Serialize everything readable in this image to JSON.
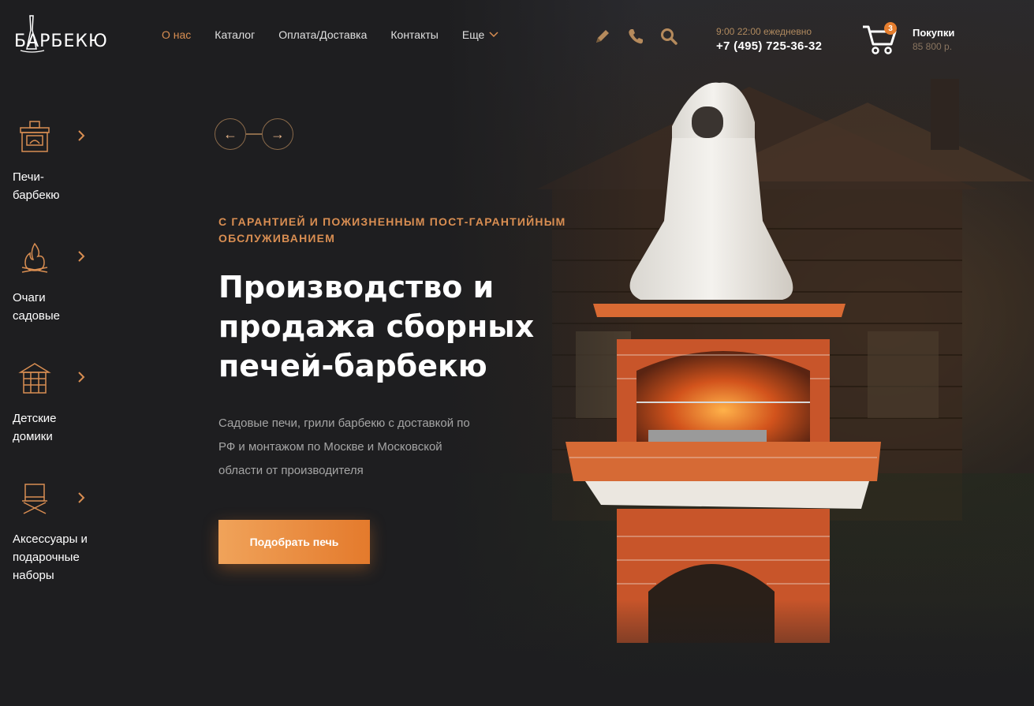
{
  "brand": {
    "logo_text": "БАРБЕКЮ"
  },
  "nav": {
    "items": [
      {
        "label": "О нас",
        "active": true
      },
      {
        "label": "Каталог",
        "active": false
      },
      {
        "label": "Оплата/Доставка",
        "active": false
      },
      {
        "label": "Контакты",
        "active": false
      }
    ],
    "more_label": "Еще"
  },
  "header": {
    "icons": [
      "pencil-icon",
      "phone-icon",
      "search-icon"
    ],
    "hours": "9:00 22:00 ежедневно",
    "phone": "+7 (495) 725-36-32",
    "cart": {
      "badge": "3",
      "label": "Покупки",
      "total": "85 800 р."
    }
  },
  "sidebar": {
    "items": [
      {
        "icon": "stove-icon",
        "label_line1": "Печи-",
        "label_line2": "барбекю",
        "label_line3": ""
      },
      {
        "icon": "fire-icon",
        "label_line1": "Очаги",
        "label_line2": "садовые",
        "label_line3": ""
      },
      {
        "icon": "gazebo-icon",
        "label_line1": "Детские",
        "label_line2": "домики",
        "label_line3": ""
      },
      {
        "icon": "chair-icon",
        "label_line1": "Аксессуары и",
        "label_line2": "подарочные",
        "label_line3": "наборы"
      }
    ]
  },
  "hero": {
    "eyebrow": "С ГАРАНТИЕЙ И ПОЖИЗНЕННЫМ ПОСТ-ГАРАНТИЙНЫМ ОБСЛУЖИВАНИЕМ",
    "headline_line1": "Производство и",
    "headline_line2": "продажа сборных",
    "headline_line3": "печей-барбекю",
    "subtext": "Садовые печи, грили барбекю с доставкой по РФ и монтажом по Москве и Московской области от производителя",
    "cta_label": "Подобрать печь",
    "prev_arrow": "←",
    "next_arrow": "→"
  },
  "colors": {
    "accent": "#d98e52",
    "cta_start": "#f0a35a",
    "cta_end": "#e47a2c",
    "background": "#1e1e20",
    "brick": "#c8552a"
  }
}
